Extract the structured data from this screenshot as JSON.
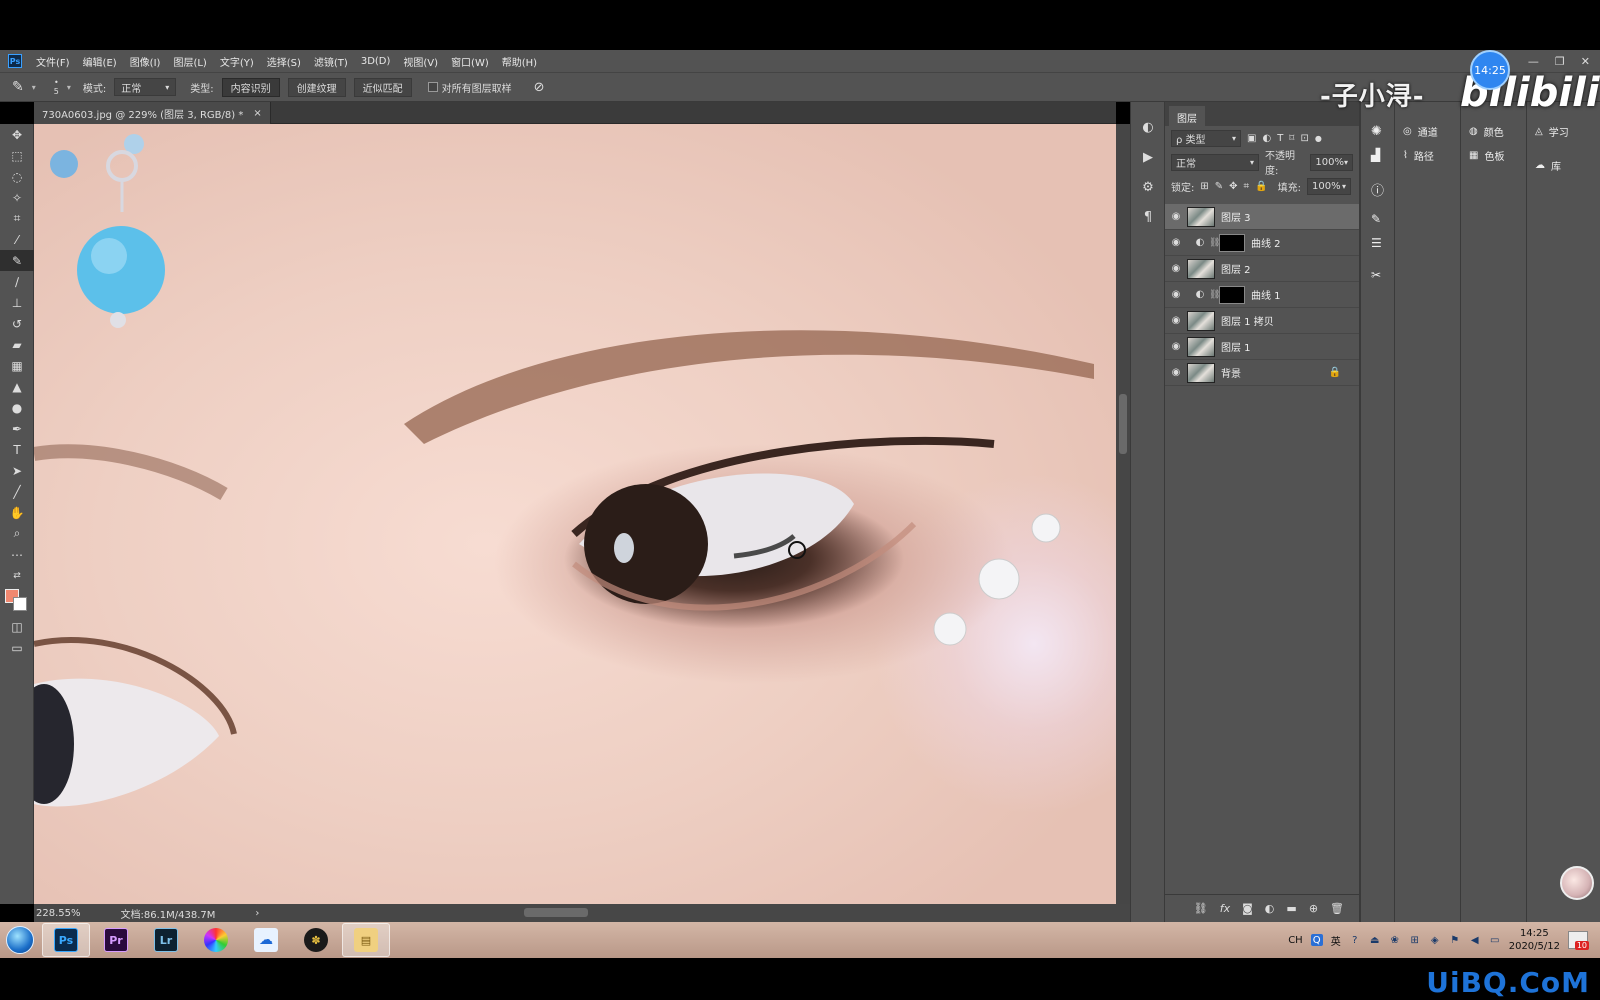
{
  "app": {
    "logo": "Ps",
    "menu": [
      "文件(F)",
      "编辑(E)",
      "图像(I)",
      "图层(L)",
      "文字(Y)",
      "选择(S)",
      "滤镜(T)",
      "3D(D)",
      "视图(V)",
      "窗口(W)",
      "帮助(H)"
    ],
    "window_controls": {
      "minimize": "—",
      "restore": "❐",
      "close": "✕"
    }
  },
  "options_bar": {
    "brush_size": "5",
    "mode_label": "模式:",
    "mode_value": "正常",
    "type_label": "类型:",
    "type_buttons": [
      "内容识别",
      "创建纹理",
      "近似匹配"
    ],
    "active_type_index": 0,
    "sample_all_layers": "对所有图层取样"
  },
  "document": {
    "tab_title": "730A0603.jpg @ 229% (图层 3, RGB/8) *",
    "tab_close": "×"
  },
  "status_bar": {
    "zoom": "228.55%",
    "doc_size": "文档:86.1M/438.7M",
    "arrow": "›"
  },
  "layers_panel": {
    "tab": "图层",
    "filter_label": "ρ 类型",
    "blend_mode": "正常",
    "opacity_label": "不透明度:",
    "opacity_value": "100%",
    "lock_label": "锁定:",
    "fill_label": "填充:",
    "fill_value": "100%",
    "layers": [
      {
        "name": "图层 3",
        "kind": "pixel",
        "selected": true,
        "locked": false
      },
      {
        "name": "曲线 2",
        "kind": "adjustment",
        "selected": false,
        "locked": false
      },
      {
        "name": "图层 2",
        "kind": "pixel",
        "selected": false,
        "locked": false
      },
      {
        "name": "曲线 1",
        "kind": "adjustment",
        "selected": false,
        "locked": false
      },
      {
        "name": "图层 1 拷贝",
        "kind": "pixel",
        "selected": false,
        "locked": false
      },
      {
        "name": "图层 1",
        "kind": "pixel",
        "selected": false,
        "locked": false
      },
      {
        "name": "背景",
        "kind": "pixel",
        "selected": false,
        "locked": true
      }
    ],
    "footer_icons": [
      "link-icon",
      "fx-icon",
      "mask-icon",
      "adjustment-icon",
      "folder-icon",
      "new-layer-icon",
      "trash-icon"
    ]
  },
  "side_panels": {
    "channels": "通道",
    "paths": "路径",
    "color": "颜色",
    "swatches": "色板",
    "learn": "学习",
    "libraries": "库"
  },
  "overlay": {
    "uploader": "-子小浔-",
    "bili": "bilibili",
    "time_badge": "14:25"
  },
  "taskbar": {
    "apps": [
      {
        "label": "Ps",
        "active": true,
        "color": "#0a2b4d",
        "fg": "#39a9ff"
      },
      {
        "label": "Pr",
        "active": false,
        "color": "#2a0a3d",
        "fg": "#d69cff"
      },
      {
        "label": "Lr",
        "active": false,
        "color": "#0d2130",
        "fg": "#7ec0e8"
      },
      {
        "label": "",
        "active": false,
        "color": "#ffffff",
        "fg": "#e33"
      },
      {
        "label": "",
        "active": false,
        "color": "#e8f2ff",
        "fg": "#1c68d6"
      },
      {
        "label": "",
        "active": false,
        "color": "#1a1a1a",
        "fg": "#e8c040"
      },
      {
        "label": "",
        "active": true,
        "color": "#f0d080",
        "fg": "#7a5a10"
      }
    ],
    "tray_lang": "CH",
    "tray_ime": "英",
    "clock_time": "14:25",
    "clock_date": "2020/5/12",
    "notification_count": "10"
  },
  "site_watermark": "UiBQ.CoM"
}
